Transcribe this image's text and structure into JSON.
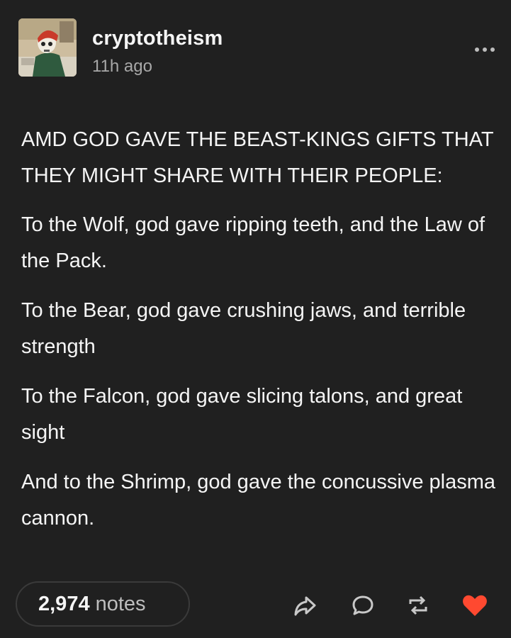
{
  "post": {
    "author": "cryptotheism",
    "time_ago": "11h ago",
    "heading": "AMD GOD GAVE THE BEAST-KINGS GIFTS THAT THEY MIGHT SHARE WITH THEIR PEOPLE:",
    "paragraphs": [
      "To the Wolf, god gave ripping teeth, and the Law of the Pack.",
      "To the Bear, god gave crushing jaws, and terrible strength",
      "To the Falcon, god gave slicing talons, and great sight",
      "And to the Shrimp, god gave the concussive plasma cannon."
    ]
  },
  "footer": {
    "notes_count": "2,974",
    "notes_label": "notes",
    "actions": [
      "share-icon",
      "reply-icon",
      "reblog-icon",
      "like-icon"
    ],
    "like_color": "#ff4930",
    "icon_color": "#c8c8c8"
  }
}
